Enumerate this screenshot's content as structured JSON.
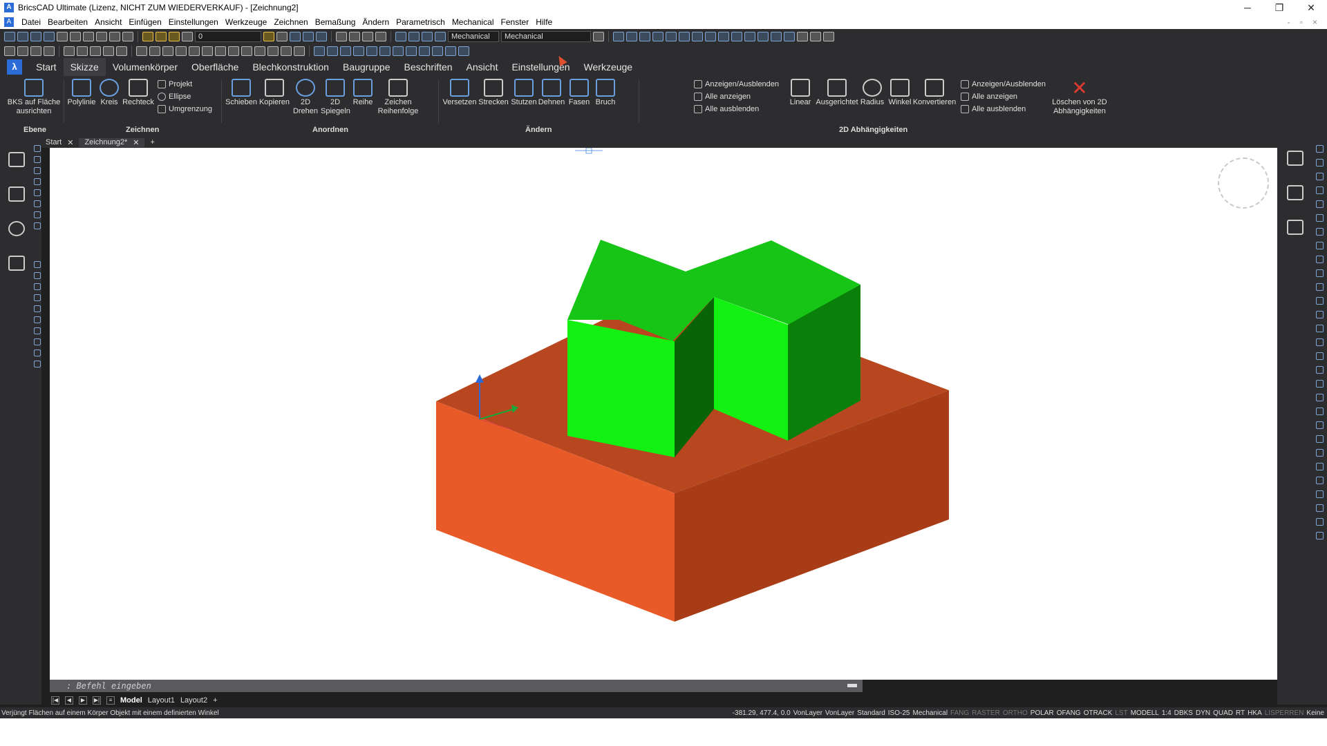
{
  "window": {
    "title": "BricsCAD Ultimate (Lizenz, NICHT ZUM WIEDERVERKAUF) - [Zeichnung2]",
    "min": "─",
    "max": "❐",
    "close": "✕"
  },
  "menubar": {
    "items": [
      "Datei",
      "Bearbeiten",
      "Ansicht",
      "Einfügen",
      "Einstellungen",
      "Werkzeuge",
      "Zeichnen",
      "Bemaßung",
      "Ändern",
      "Parametrisch",
      "Mechanical",
      "Fenster",
      "Hilfe"
    ]
  },
  "toolbar": {
    "layer_combo": "0",
    "workspace_combo1": "Mechanical",
    "workspace_combo2": "Mechanical"
  },
  "ribbon": {
    "tabs": [
      "Start",
      "Skizze",
      "Volumenkörper",
      "Oberfläche",
      "Blechkonstruktion",
      "Baugruppe",
      "Beschriften",
      "Ansicht",
      "Einstellungen",
      "Werkzeuge"
    ],
    "active_tab": "Skizze",
    "buttons": {
      "bks": "BKS auf Fläche ausrichten",
      "polylinie": "Polylinie",
      "kreis": "Kreis",
      "rechteck": "Rechteck",
      "projekt": "Projekt",
      "ellipse": "Ellipse",
      "umgrenzung": "Umgrenzung",
      "schieben": "Schieben",
      "kopieren": "Kopieren",
      "drehen": "2D Drehen",
      "spiegeln": "2D Spiegeln",
      "reihe": "Reihe",
      "zeichenreihenfolge": "Zeichen Reihenfolge",
      "versetzen": "Versetzen",
      "strecken": "Strecken",
      "stutzen": "Stutzen",
      "dehnen": "Dehnen",
      "fasen": "Fasen",
      "bruch": "Bruch",
      "anzeigen_ausblenden_1": "Anzeigen/Ausblenden",
      "alle_anzeigen_1": "Alle anzeigen",
      "alle_ausblenden_1": "Alle ausblenden",
      "linear": "Linear",
      "ausgerichtet": "Ausgerichtet",
      "radius": "Radius",
      "winkel": "Winkel",
      "konvertieren": "Konvertieren",
      "anzeigen_ausblenden_2": "Anzeigen/Ausblenden",
      "alle_anzeigen_2": "Alle anzeigen",
      "alle_ausblenden_2": "Alle ausblenden",
      "loeschen": "Löschen von 2D Abhängigkeiten"
    },
    "groups": {
      "ebene": "Ebene",
      "zeichnen": "Zeichnen",
      "anordnen": "Anordnen",
      "aendern": "Ändern",
      "abhaengigkeiten": "2D Abhängigkeiten"
    }
  },
  "doc_tabs": [
    "Start",
    "Zeichnung2*"
  ],
  "viewport": {
    "colors": {
      "base_top": "#b8471f",
      "base_left": "#e85a28",
      "base_right": "#a83c17",
      "green_top": "#16c516",
      "green_front": "#12f112",
      "green_side": "#0a7f0a",
      "green_dark": "#076507"
    }
  },
  "command_line": {
    "placeholder": ": Befehl eingeben"
  },
  "layout_tabs": [
    "Model",
    "Layout1",
    "Layout2",
    "+"
  ],
  "statusbar": {
    "message": "Verjüngt Flächen auf einem Körper Objekt mit einem definierten Winkel",
    "coords": "-381.29, 477.4, 0.0",
    "items": [
      {
        "label": "VonLayer",
        "on": true
      },
      {
        "label": "VonLayer",
        "on": true
      },
      {
        "label": "Standard",
        "on": true
      },
      {
        "label": "ISO-25",
        "on": true
      },
      {
        "label": "Mechanical",
        "on": true
      },
      {
        "label": "FANG",
        "on": false
      },
      {
        "label": "RASTER",
        "on": false
      },
      {
        "label": "ORTHO",
        "on": false
      },
      {
        "label": "POLAR",
        "on": true
      },
      {
        "label": "OFANG",
        "on": true
      },
      {
        "label": "OTRACK",
        "on": true
      },
      {
        "label": "LST",
        "on": false
      },
      {
        "label": "MODELL",
        "on": true
      },
      {
        "label": "1:4",
        "on": true
      },
      {
        "label": "DBKS",
        "on": true
      },
      {
        "label": "DYN",
        "on": true
      },
      {
        "label": "QUAD",
        "on": true
      },
      {
        "label": "RT",
        "on": true
      },
      {
        "label": "HKA",
        "on": true
      },
      {
        "label": "LISPERREN",
        "on": false
      },
      {
        "label": "Keine",
        "on": true
      }
    ]
  }
}
